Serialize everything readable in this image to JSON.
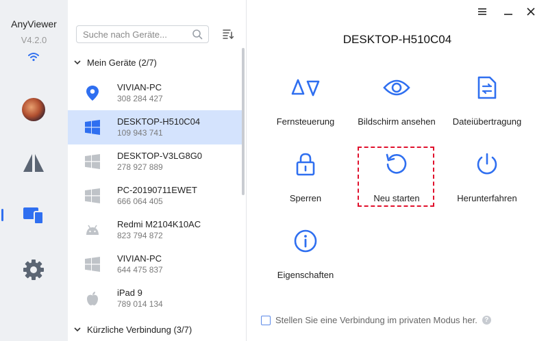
{
  "app": {
    "name": "AnyViewer",
    "version": "V4.2.0"
  },
  "search": {
    "placeholder": "Suche nach Geräte..."
  },
  "groups": [
    {
      "label": "Mein Geräte (2/7)"
    },
    {
      "label": "Kürzliche Verbindung (3/7)"
    }
  ],
  "devices": [
    {
      "name": "VIVIAN-PC",
      "id": "308 284 427",
      "icon": "location-pin-icon"
    },
    {
      "name": "DESKTOP-H510C04",
      "id": "109 943 741",
      "icon": "windows-icon"
    },
    {
      "name": "DESKTOP-V3LG8G0",
      "id": "278 927 889",
      "icon": "windows-icon"
    },
    {
      "name": "PC-20190711EWET",
      "id": "666 064 405",
      "icon": "windows-icon"
    },
    {
      "name": "Redmi M2104K10AC",
      "id": "823 794 872",
      "icon": "android-icon"
    },
    {
      "name": "VIVIAN-PC",
      "id": "644 475 837",
      "icon": "windows-icon"
    },
    {
      "name": "iPad 9",
      "id": "789 014 134",
      "icon": "apple-icon"
    }
  ],
  "selected_device": "DESKTOP-H510C04",
  "main": {
    "title": "DESKTOP-H510C04",
    "actions": [
      {
        "label": "Fernsteuerung"
      },
      {
        "label": "Bildschirm ansehen"
      },
      {
        "label": "Dateiübertragung"
      },
      {
        "label": "Sperren"
      },
      {
        "label": "Neu starten"
      },
      {
        "label": "Herunterfahren"
      },
      {
        "label": "Eigenschaften"
      }
    ],
    "private_mode_label": "Stellen Sie eine Verbindung im privaten Modus her.",
    "help_glyph": "?"
  },
  "colors": {
    "accent": "#2f6ff0",
    "selected_row": "#d4e3fd",
    "highlight": "#e0102c",
    "rail": "#eef0f3"
  }
}
